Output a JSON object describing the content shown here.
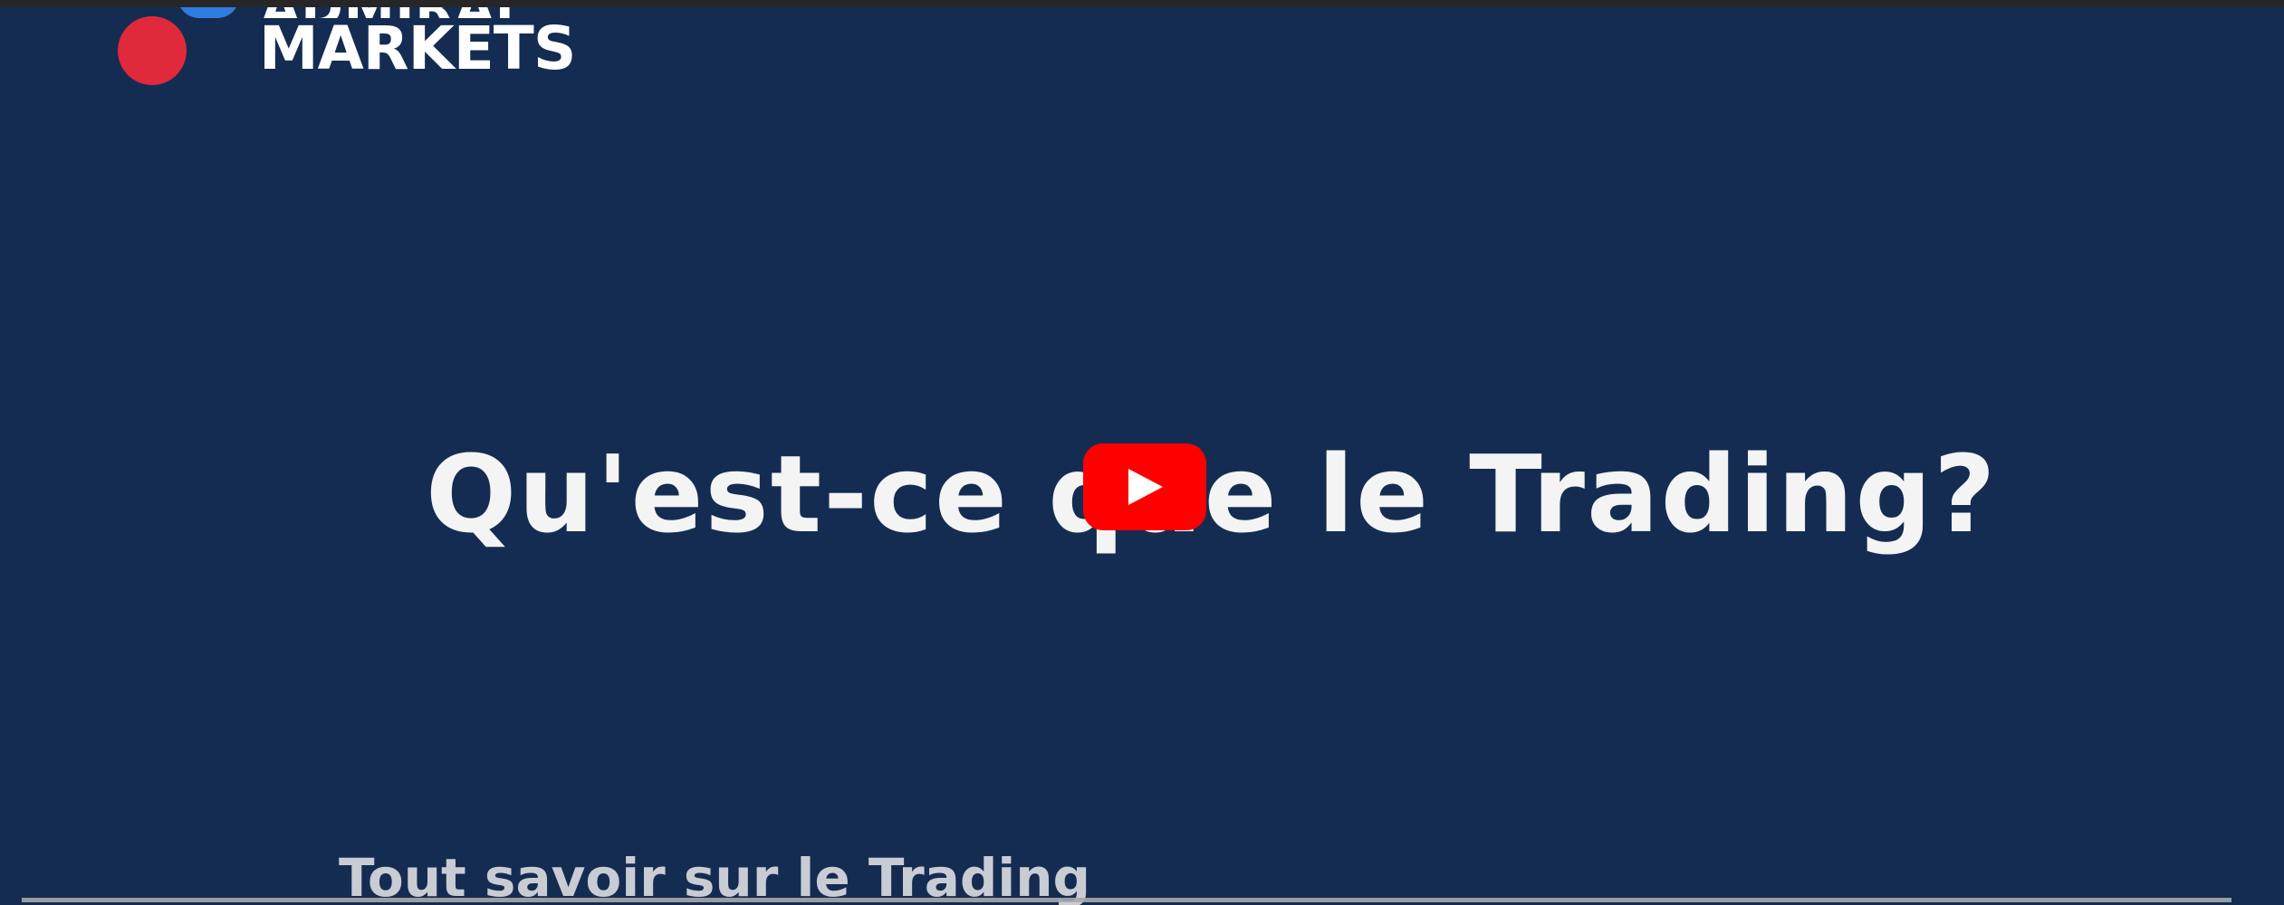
{
  "video": {
    "brand_top": "ADMIRAL",
    "brand": "MARKETS",
    "headline": "Qu'est-ce que le Trading?",
    "subtitle": "Tout savoir sur le Trading",
    "play_icon": "youtube-play-icon",
    "colors": {
      "background": "#142c52",
      "play_button": "#ff0000",
      "logo_red": "#e0293a",
      "logo_blue": "#2f7de1",
      "headline": "#f4f4f4"
    }
  }
}
